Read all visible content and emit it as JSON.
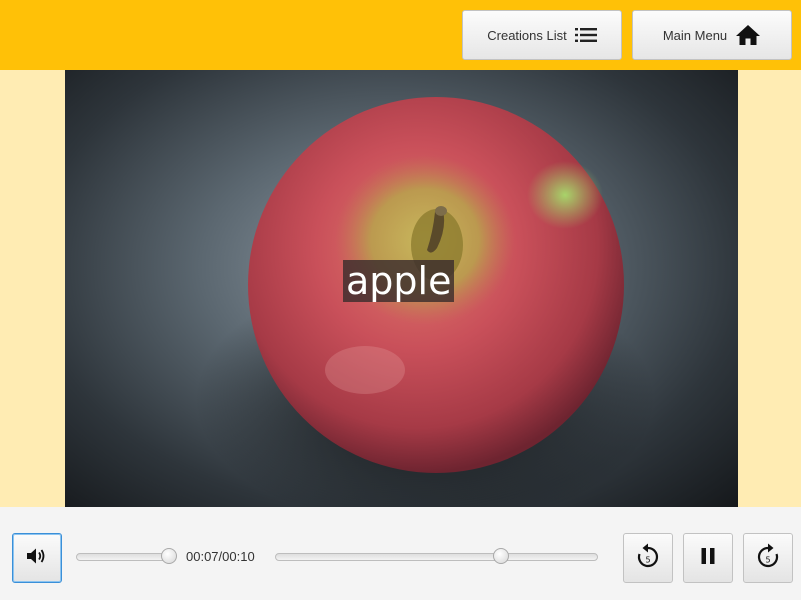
{
  "header": {
    "creations_button": {
      "label": "Creations List",
      "icon": "list-icon"
    },
    "main_menu_button": {
      "label": "Main Menu",
      "icon": "home-icon"
    },
    "background_color": "#ffc107"
  },
  "stage": {
    "background_color": "#ffecb3",
    "image_subject": "apple",
    "caption": "apple"
  },
  "controls": {
    "volume_icon": "speaker-icon",
    "volume_level": 0.94,
    "time_display": "00:07/00:10",
    "progress": 0.7,
    "rewind_icon": "rewind-5-icon",
    "rewind_seconds": "5",
    "pause_icon": "pause-icon",
    "forward_icon": "forward-5-icon",
    "forward_seconds": "5"
  }
}
